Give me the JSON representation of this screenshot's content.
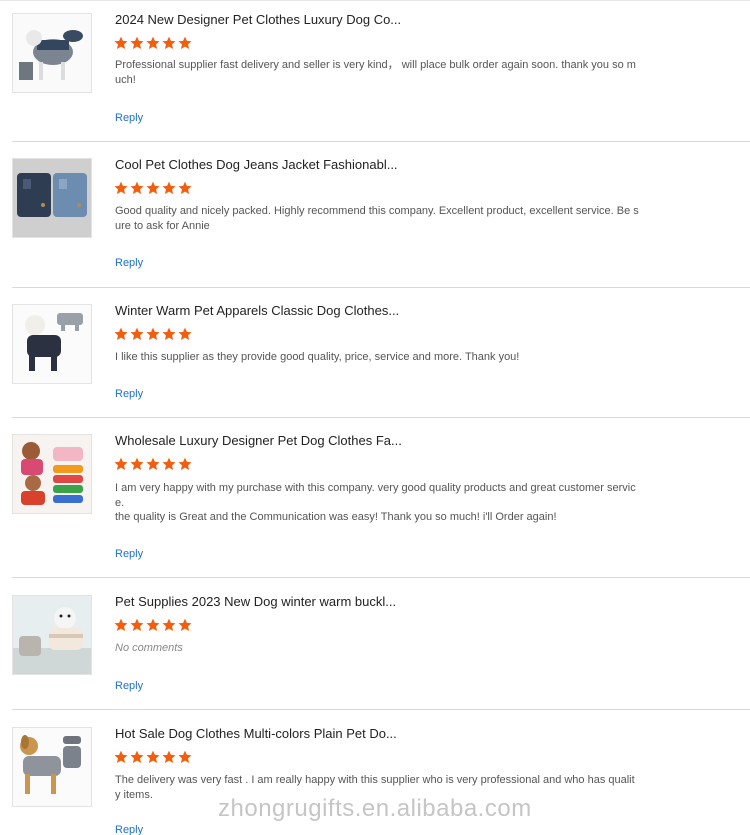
{
  "colors": {
    "star": "#f35e0e",
    "reply": "#1d6fd1",
    "divider": "#d9d9d9"
  },
  "reviews": [
    {
      "title": "2024 New Designer Pet Clothes Luxury Dog Co...",
      "rating": 5,
      "comment": "Professional supplier fast delivery and seller is very kind， will place bulk order again soon. thank you so much!",
      "reply": "Reply",
      "image": "dog-jacket-gray-blue"
    },
    {
      "title": "Cool Pet Clothes Dog Jeans Jacket Fashionabl...",
      "rating": 5,
      "comment": "Good quality and nicely packed. Highly recommend this company. Excellent product, excellent service. Be sure to ask for Annie",
      "reply": "Reply",
      "image": "dog-denim-jackets"
    },
    {
      "title": "Winter Warm Pet Apparels Classic Dog Clothes...",
      "rating": 5,
      "comment": "I like this supplier as they provide good quality, price, service and more. Thank you!",
      "reply": "Reply",
      "image": "dog-winter-suit"
    },
    {
      "title": "Wholesale Luxury Designer Pet Dog Clothes Fa...",
      "rating": 5,
      "comment": "I am very happy with my purchase with this company. very good quality products and great customer service.\nthe quality is Great and the Communication was easy! Thank you so much! i'll Order again!",
      "reply": "Reply",
      "image": "dog-colorful-coats"
    },
    {
      "title": "Pet Supplies 2023 New Dog winter warm buckl...",
      "rating": 5,
      "comment": "No comments",
      "comment_empty": true,
      "reply": "Reply",
      "image": "dog-winter-buckle"
    },
    {
      "title": "Hot Sale Dog Clothes Multi-colors Plain Pet Do...",
      "rating": 5,
      "comment": "The delivery was very fast . I am really happy with this supplier who is very professional and who has quality items.",
      "reply": "Reply",
      "image": "dog-plain-sweater"
    }
  ],
  "watermark": "zhongrugifts.en.alibaba.com"
}
